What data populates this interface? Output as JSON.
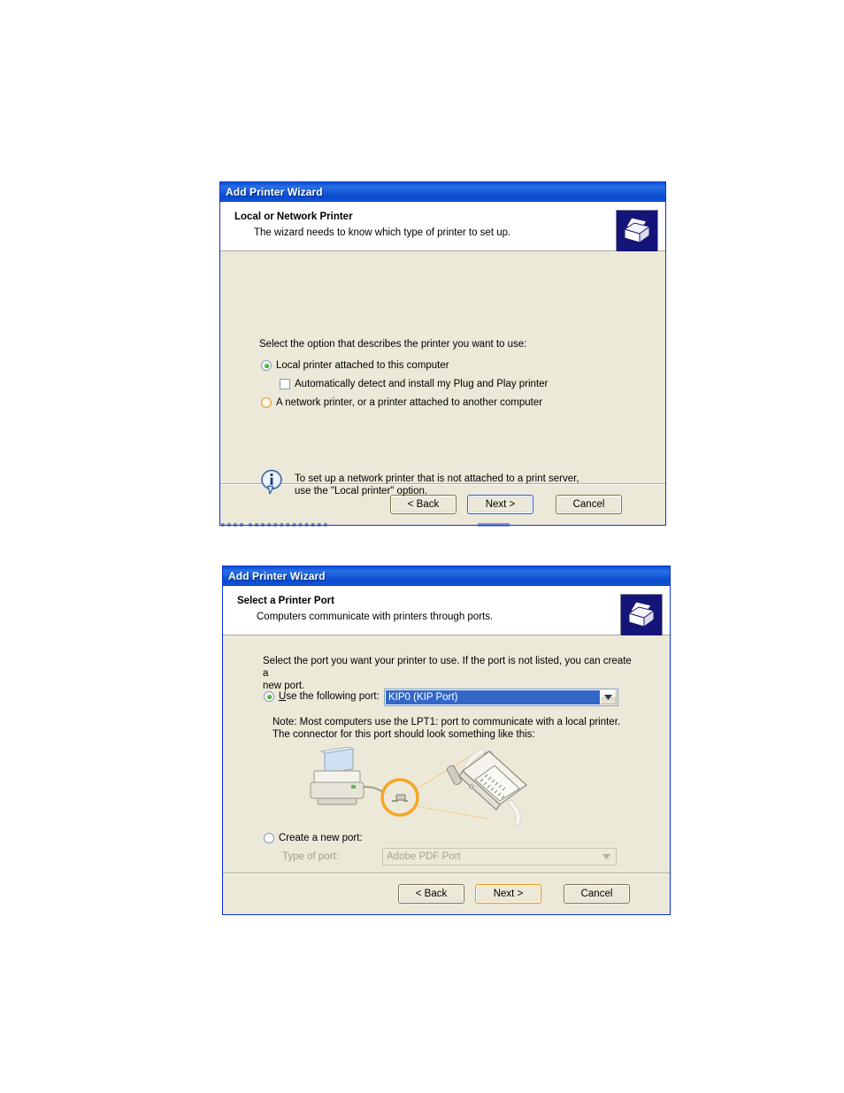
{
  "dialog1": {
    "titlebar": {
      "title": "Add Printer Wizard"
    },
    "header": {
      "title": "Local or Network Printer",
      "subtitle": "The wizard needs to know which type of printer to set up.",
      "icon": "printer-banner-icon"
    },
    "body": {
      "prompt": "Select the option that describes the printer you want to use:",
      "options": [
        {
          "id": "local-printer",
          "label": "Local printer attached to this computer",
          "type": "radio",
          "state": "selected"
        },
        {
          "id": "autodetect",
          "label": "Automatically detect and install my Plug and Play printer",
          "type": "checkbox",
          "state": "unchecked"
        },
        {
          "id": "network-printer",
          "label": "A network printer, or a printer attached to another computer",
          "type": "radio",
          "state": "unselected"
        }
      ],
      "note": {
        "icon": "info-icon",
        "line1": "To set up a network printer that is not attached to a print server,",
        "line2": "use the \"Local printer\" option."
      }
    },
    "footer": {
      "back": "< Back",
      "next": "Next >",
      "cancel": "Cancel",
      "focus": "next-button",
      "focus_color": "#2a5fd4"
    }
  },
  "dialog2": {
    "titlebar": {
      "title": "Add Printer Wizard"
    },
    "header": {
      "title": "Select a Printer Port",
      "subtitle": "Computers communicate with printers through ports.",
      "icon": "printer-banner-icon"
    },
    "body": {
      "prompt_line1": "Select the port you want your printer to use.  If the port is not listed, you can create a",
      "prompt_line2": "new port.",
      "use_port": {
        "label": "Use the following port:",
        "state": "selected",
        "value": "KIP0 (KIP Port)",
        "value_highlight_color": "#3267c8"
      },
      "note_line1": "Note: Most computers use the LPT1: port to communicate with a local printer.",
      "note_line2": "The connector for this port should look something like this:",
      "illustration": {
        "name": "printer-parallel-connector-illustration",
        "parts": [
          "printer-icon",
          "cable",
          "highlight-circle",
          "db25-connector"
        ],
        "highlight_color": "#f5a623"
      },
      "create_port": {
        "label": "Create a new port:",
        "state": "unselected",
        "type_label": "Type of port:",
        "type_value": "Adobe PDF Port",
        "disabled": true
      }
    },
    "footer": {
      "back": "< Back",
      "next": "Next >",
      "cancel": "Cancel",
      "focus": "next-button",
      "focus_color": "#e09423"
    }
  }
}
